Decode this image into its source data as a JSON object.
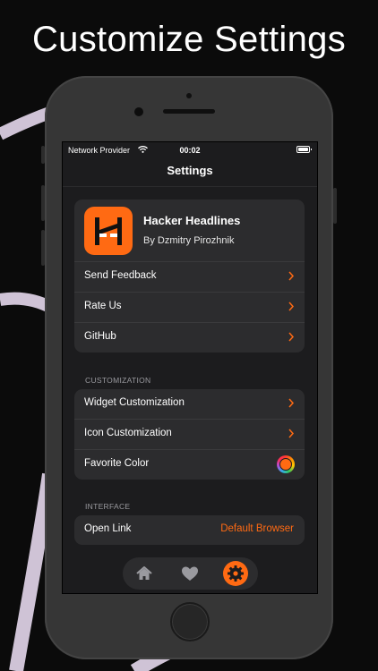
{
  "headline": "Customize Settings",
  "status_bar": {
    "carrier": "Network Provider",
    "time": "00:02"
  },
  "nav": {
    "title": "Settings"
  },
  "app": {
    "name": "Hacker Headlines",
    "author": "By Dzmitry Pirozhnik",
    "icon": "letter-H-logo"
  },
  "about_rows": [
    {
      "label": "Send Feedback"
    },
    {
      "label": "Rate Us"
    },
    {
      "label": "GitHub"
    }
  ],
  "customization": {
    "header": "CUSTOMIZATION",
    "rows": [
      {
        "label": "Widget Customization"
      },
      {
        "label": "Icon Customization"
      },
      {
        "label": "Favorite Color"
      }
    ],
    "favorite_color": "#ff6a13"
  },
  "interface": {
    "header": "INTERFACE",
    "open_link_label": "Open Link",
    "open_link_value": "Default Browser"
  },
  "tab_bar": [
    {
      "icon": "house-icon",
      "active": false
    },
    {
      "icon": "heart-icon",
      "active": false
    },
    {
      "icon": "gear-icon",
      "active": true
    }
  ],
  "colors": {
    "accent": "#ff6a13",
    "card": "#2c2c2e",
    "screen_bg": "#1c1c1e"
  }
}
